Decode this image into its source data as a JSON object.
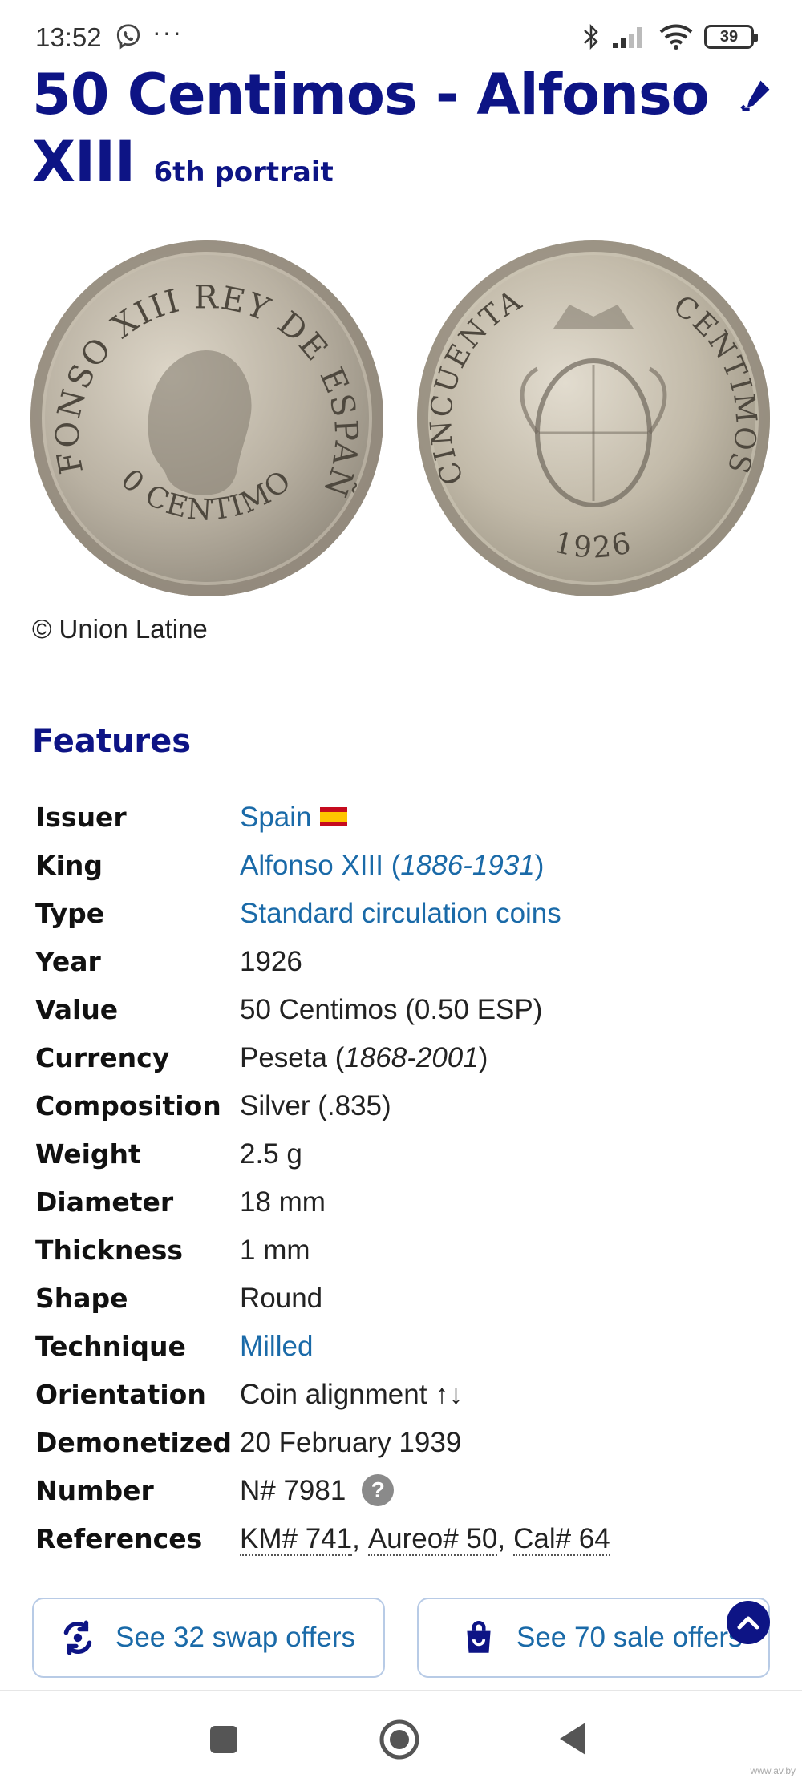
{
  "status_bar": {
    "time": "13:52",
    "dots": "···",
    "battery": "39",
    "icons": [
      "viber-icon",
      "bluetooth-icon",
      "signal-icon",
      "wifi-icon",
      "battery-icon"
    ]
  },
  "title": {
    "main": "50 Centimos - Alfonso XIII",
    "subtitle": "6th portrait"
  },
  "images": {
    "obverse": {
      "legend": "ALFONSO XIII REY DE ESPAÑA",
      "value": "50 CENTIMOS"
    },
    "reverse": {
      "legend_left": "CINCUENTA",
      "legend_right": "CENTIMOS",
      "year": "1926"
    },
    "copyright": "© Union Latine"
  },
  "features": {
    "heading": "Features",
    "rows": [
      {
        "label": "Issuer",
        "value": "Spain",
        "link": true
      },
      {
        "label": "King",
        "value": "Alfonso XIII (",
        "value_italic": "1886-1931",
        "value_end": ")",
        "link": true
      },
      {
        "label": "Type",
        "value": "Standard circulation coins",
        "link": true
      },
      {
        "label": "Year",
        "value": "1926"
      },
      {
        "label": "Value",
        "value": "50 Centimos (0.50 ESP)"
      },
      {
        "label": "Currency",
        "value": "Peseta (",
        "value_italic": "1868-2001",
        "value_end": ")"
      },
      {
        "label": "Composition",
        "value": "Silver (.835)"
      },
      {
        "label": "Weight",
        "value": "2.5 g"
      },
      {
        "label": "Diameter",
        "value": "18 mm"
      },
      {
        "label": "Thickness",
        "value": "1 mm"
      },
      {
        "label": "Shape",
        "value": "Round"
      },
      {
        "label": "Technique",
        "value": "Milled",
        "link": true
      },
      {
        "label": "Orientation",
        "value": "Coin alignment ↑↓"
      },
      {
        "label": "Demonetized",
        "value": "20 February 1939"
      },
      {
        "label": "Number",
        "value": "N# 7981",
        "help": "?"
      },
      {
        "label": "References",
        "refs": [
          "KM# 741",
          "Aureo# 50",
          "Cal# 64"
        ],
        "separator": ","
      }
    ]
  },
  "actions": {
    "swap_label": "See 32 swap offers",
    "sale_label": "See 70 sale offers"
  },
  "watermark": "www.av.by",
  "colors": {
    "title": "#0d1485",
    "link": "#1a6aa8",
    "button_border": "#b8cbe6"
  }
}
